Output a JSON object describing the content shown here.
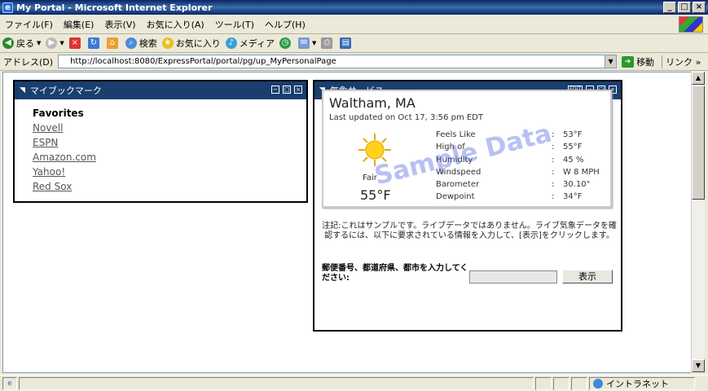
{
  "window": {
    "title": "My Portal - Microsoft Internet Explorer"
  },
  "menu": [
    "ファイル(F)",
    "編集(E)",
    "表示(V)",
    "お気に入り(A)",
    "ツール(T)",
    "ヘルプ(H)"
  ],
  "toolbar": {
    "back": "戻る",
    "search": "検索",
    "favorites": "お気に入り",
    "media": "メディア"
  },
  "address": {
    "label": "アドレス(D)",
    "url": "http://localhost:8080/ExpressPortal/portal/pg/up_MyPersonalPage",
    "go": "移動",
    "links": "リンク"
  },
  "bookmarks": {
    "title": "マイブックマーク",
    "heading": "Favorites",
    "items": [
      "Novell",
      "ESPN",
      "Amazon.com",
      "Yahoo!",
      "Red Sox"
    ]
  },
  "weather": {
    "title": "気象サービス",
    "edit": "EDIT",
    "city": "Waltham, MA",
    "updated": "Last updated on Oct 17, 3:56 pm EDT",
    "condition": "Fair",
    "temp": "55°F",
    "watermark": "Sample Data",
    "rows": [
      {
        "k": "Feels Like",
        "v": "53°F"
      },
      {
        "k": "High of",
        "v": "55°F"
      },
      {
        "k": "Humidity",
        "v": "45 %"
      },
      {
        "k": "Windspeed",
        "v": "W 8 MPH"
      },
      {
        "k": "Barometer",
        "v": "30.10\""
      },
      {
        "k": "Dewpoint",
        "v": "34°F"
      }
    ],
    "note": "注記:これはサンプルです。ライブデータではありません。ライブ気象データを確認するには、以下に要求されている情報を入力して、[表示]をクリックします。",
    "zip_label": "郵便番号、都道府県、都市を入力してください:",
    "zip_value": "",
    "show_button": "表示"
  },
  "status": {
    "zone": "イントラネット"
  }
}
